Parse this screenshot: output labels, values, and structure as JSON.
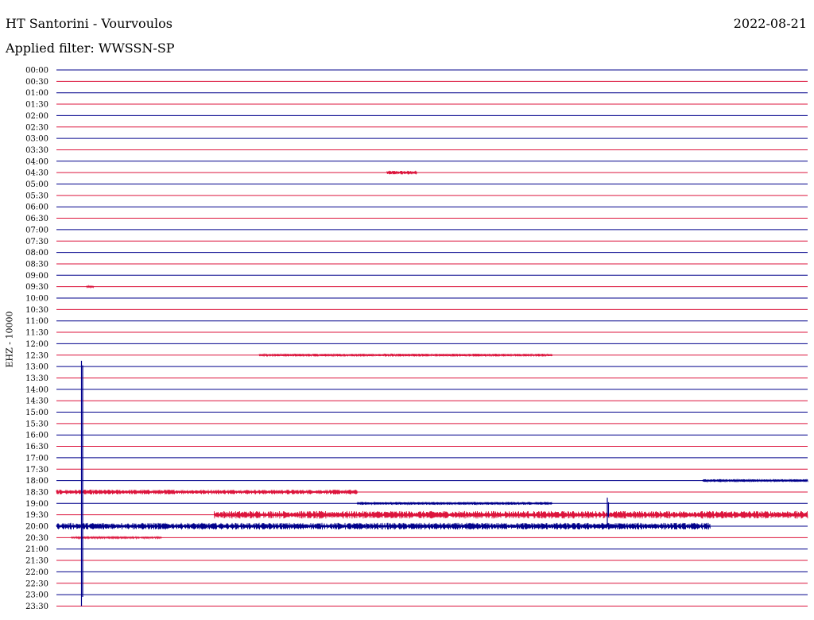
{
  "header": {
    "station": "HT Santorini - Vourvoulos",
    "filter": "Applied filter: WWSSN-SP",
    "date": "2022-08-21"
  },
  "chart_data": {
    "type": "line",
    "title": "HT Santorini - Vourvoulos",
    "subtitle": "Applied filter: WWSSN-SP",
    "ylabel": "EHZ - 10000",
    "colors": {
      "trace_a": "#00008b",
      "trace_b": "#dc143c"
    },
    "row_labels": [
      "00:00",
      "00:30",
      "01:00",
      "01:30",
      "02:00",
      "02:30",
      "03:00",
      "03:30",
      "04:00",
      "04:30",
      "05:00",
      "05:30",
      "06:00",
      "06:30",
      "07:00",
      "07:30",
      "08:00",
      "08:30",
      "09:00",
      "09:30",
      "10:00",
      "10:30",
      "11:00",
      "11:30",
      "12:00",
      "12:30",
      "13:00",
      "13:30",
      "14:00",
      "14:30",
      "15:00",
      "15:30",
      "16:00",
      "16:30",
      "17:00",
      "17:30",
      "18:00",
      "18:30",
      "19:00",
      "19:30",
      "20:00",
      "20:30",
      "21:00",
      "21:30",
      "22:00",
      "22:30",
      "23:00",
      "23:30"
    ],
    "activity": [
      {
        "row": "04:30",
        "from": 0.44,
        "to": 0.48,
        "amplitude": 2
      },
      {
        "row": "09:30",
        "from": 0.04,
        "to": 0.05,
        "amplitude": 1
      },
      {
        "row": "12:30",
        "from": 0.27,
        "to": 0.66,
        "amplitude": 1.5
      },
      {
        "row": "18:00",
        "from": 0.86,
        "to": 1.0,
        "amplitude": 1.5
      },
      {
        "row": "18:30",
        "from": 0.0,
        "to": 0.4,
        "amplitude": 2.5
      },
      {
        "row": "19:00",
        "from": 0.4,
        "to": 0.66,
        "amplitude": 1.5
      },
      {
        "row": "19:30",
        "from": 0.21,
        "to": 1.0,
        "amplitude": 4
      },
      {
        "row": "20:00",
        "from": 0.0,
        "to": 0.87,
        "amplitude": 3.5
      },
      {
        "row": "20:30",
        "from": 0.02,
        "to": 0.14,
        "amplitude": 1
      }
    ],
    "events": [
      {
        "time": "13:01",
        "peak_rows": 21
      },
      {
        "time": "19:22",
        "peak_rows": 2
      }
    ]
  }
}
